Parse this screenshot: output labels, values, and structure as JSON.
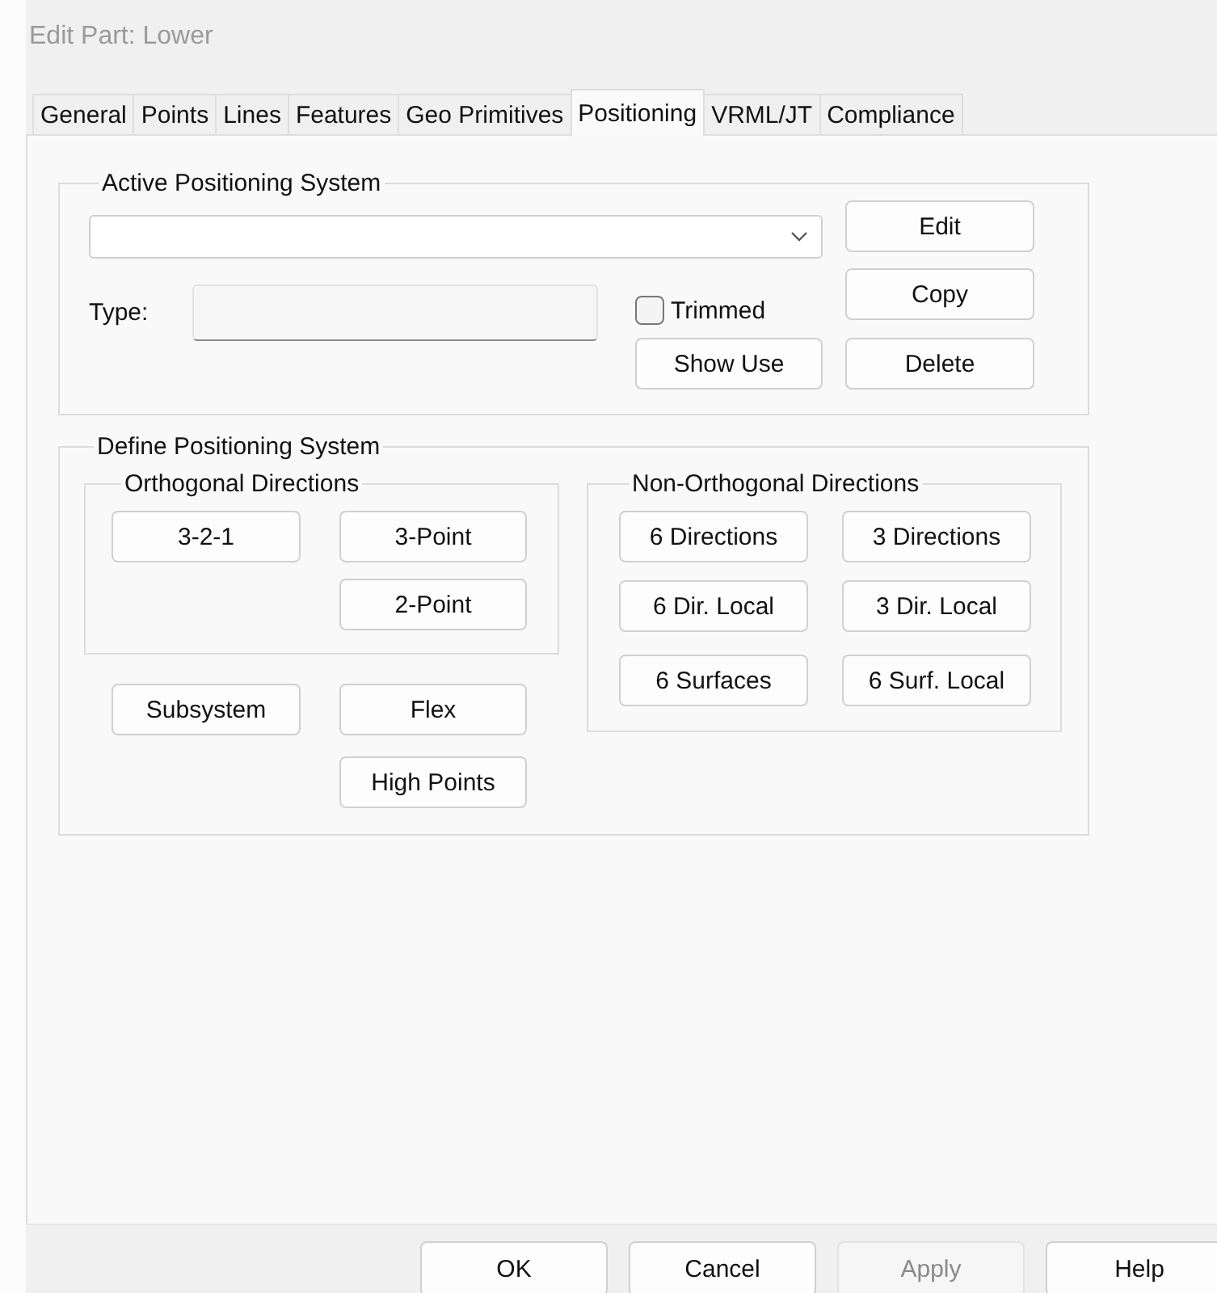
{
  "window": {
    "title": "Edit Part: Lower"
  },
  "tabs": [
    {
      "label": "General",
      "selected": false
    },
    {
      "label": "Points",
      "selected": false
    },
    {
      "label": "Lines",
      "selected": false
    },
    {
      "label": "Features",
      "selected": false
    },
    {
      "label": "Geo Primitives",
      "selected": false
    },
    {
      "label": "Positioning",
      "selected": true
    },
    {
      "label": "VRML/JT",
      "selected": false
    },
    {
      "label": "Compliance",
      "selected": false
    }
  ],
  "active_positioning_system": {
    "title": "Active Positioning System",
    "type_label": "Type:",
    "trimmed": {
      "label": "Trimmed",
      "checked": false
    },
    "edit": "Edit",
    "copy": "Copy",
    "show_use": "Show Use",
    "delete": "Delete"
  },
  "define_positioning_system": {
    "title": "Define Positioning System",
    "orthogonal": {
      "title": "Orthogonal Directions",
      "buttons": [
        "3-2-1",
        "3-Point",
        "2-Point"
      ]
    },
    "non_orthogonal": {
      "title": "Non-Orthogonal Directions",
      "buttons": [
        "6 Directions",
        "3 Directions",
        "6 Dir. Local",
        "3 Dir. Local",
        "6 Surfaces",
        "6 Surf. Local"
      ]
    },
    "subsystem": "Subsystem",
    "flex": "Flex",
    "high_points": "High Points"
  },
  "footer_buttons": [
    {
      "label": "OK",
      "disabled": false
    },
    {
      "label": "Cancel",
      "disabled": false
    },
    {
      "label": "Apply",
      "disabled": true
    },
    {
      "label": "Help",
      "disabled": false
    }
  ]
}
